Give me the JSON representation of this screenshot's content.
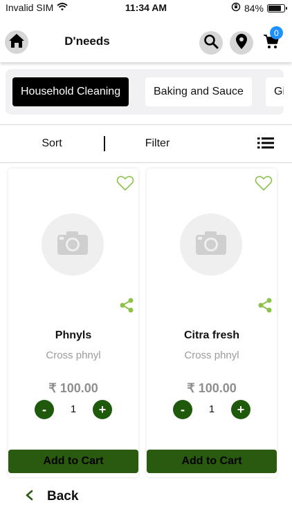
{
  "status_bar": {
    "carrier": "Invalid SIM",
    "time": "11:34 AM",
    "battery": "84%",
    "battery_level": 0.84
  },
  "header": {
    "title": "D'needs",
    "cart_count": "0"
  },
  "categories": [
    {
      "label": "Household Cleaning",
      "active": true
    },
    {
      "label": "Baking and Sauce",
      "active": false
    },
    {
      "label": "Gi",
      "active": false
    }
  ],
  "toolbar": {
    "sort_label": "Sort",
    "filter_label": "Filter"
  },
  "products": [
    {
      "name": "Phnyls",
      "subtitle": "Cross phnyl",
      "price": "₹ 100.00",
      "quantity": "1",
      "minus": "-",
      "plus": "+",
      "add_label": "Add to Cart"
    },
    {
      "name": "Citra fresh",
      "subtitle": "Cross phnyl",
      "price": "₹ 100.00",
      "quantity": "1",
      "minus": "-",
      "plus": "+",
      "add_label": "Add to Cart"
    }
  ],
  "footer": {
    "back_label": "Back"
  },
  "colors": {
    "accent_green": "#1f5a0c",
    "icon_green": "#8bc34a",
    "badge_blue": "#1e90ff"
  }
}
